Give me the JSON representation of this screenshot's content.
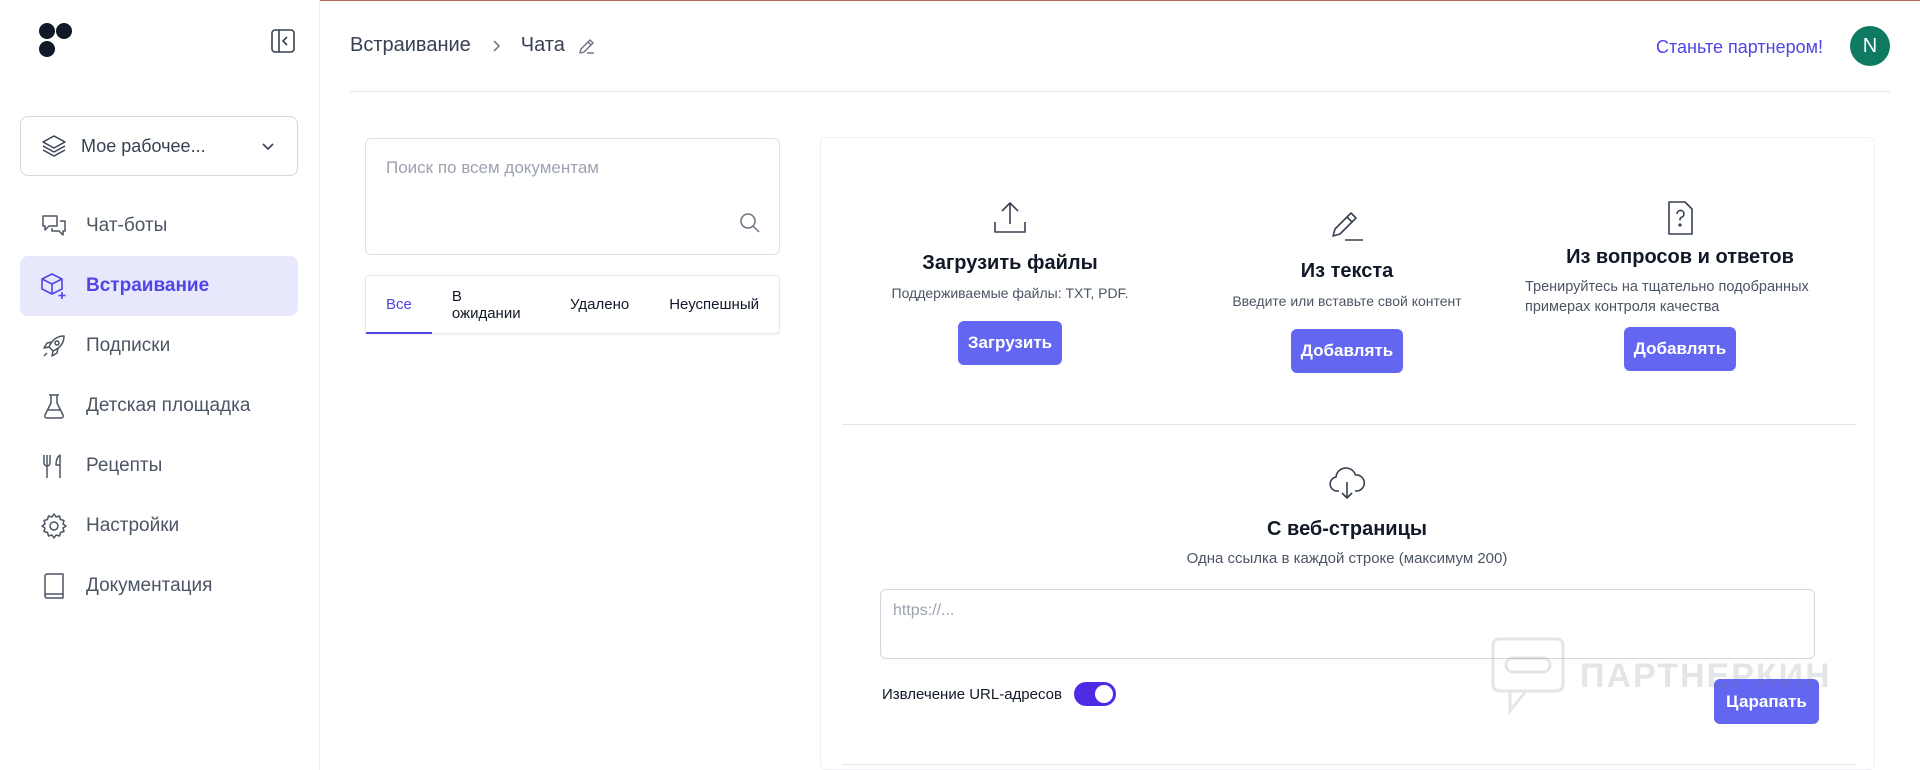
{
  "sidebar": {
    "workspace_label": "Мое рабочее...",
    "items": [
      {
        "label": "Чат-боты",
        "icon": "chat-bubbles-icon"
      },
      {
        "label": "Встраивание",
        "icon": "cube-plus-icon",
        "active": true
      },
      {
        "label": "Подписки",
        "icon": "rocket-icon"
      },
      {
        "label": "Детская площадка",
        "icon": "flask-icon"
      },
      {
        "label": "Рецепты",
        "icon": "fork-knife-icon"
      },
      {
        "label": "Настройки",
        "icon": "gear-icon"
      },
      {
        "label": "Документация",
        "icon": "book-icon"
      }
    ]
  },
  "header": {
    "breadcrumb_root": "Встраивание",
    "breadcrumb_current": "Чата",
    "partner_link": "Станьте партнером!",
    "avatar_initial": "N"
  },
  "search": {
    "placeholder": "Поиск по всем документам"
  },
  "tabs": [
    {
      "label": "Все",
      "active": true
    },
    {
      "label": "В ожидании"
    },
    {
      "label": "Удалено"
    },
    {
      "label": "Неуспешный"
    }
  ],
  "upload": {
    "title": "Загрузить файлы",
    "subtitle": "Поддерживаемые файлы: TXT, PDF.",
    "button": "Загрузить"
  },
  "from_text": {
    "title": "Из текста",
    "subtitle": "Введите или вставьте свой контент",
    "button": "Добавлять"
  },
  "from_qa": {
    "title": "Из вопросов и ответов",
    "subtitle": "Тренируйтесь на тщательно подобранных примерах контроля качества",
    "button": "Добавлять"
  },
  "web": {
    "title": "С веб-страницы",
    "subtitle": "Одна ссылка в каждой строке (максимум 200)",
    "placeholder": "https://...",
    "extract_label": "Извлечение URL-адресов",
    "extract_on": true,
    "button": "Царапать"
  },
  "watermark": {
    "text": "ПАРТНЕРКИН"
  },
  "colors": {
    "accent": "#6366f1",
    "active_bg": "#e8e8fd",
    "avatar": "#0f7a62"
  }
}
